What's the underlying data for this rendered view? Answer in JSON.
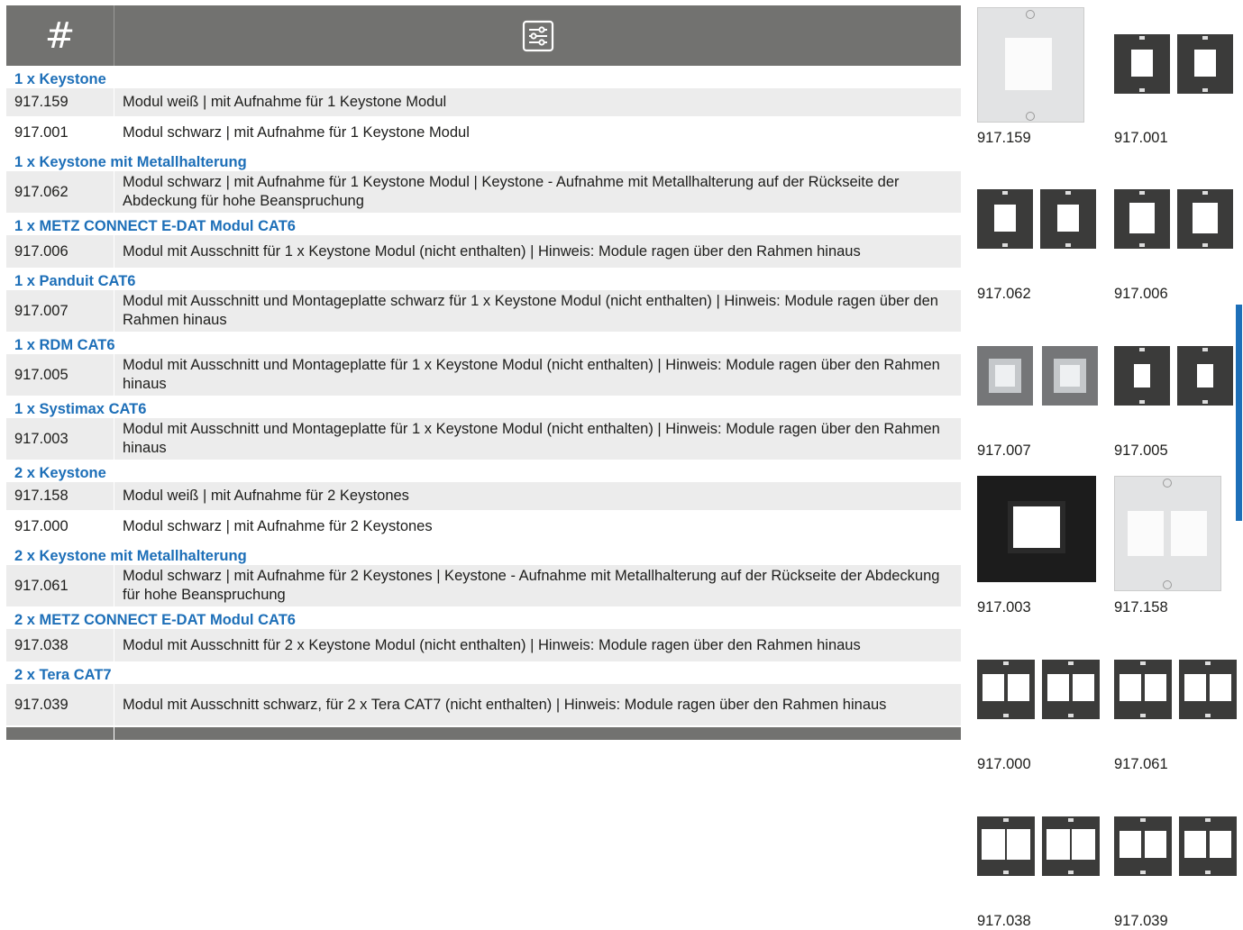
{
  "header": {
    "col1": "#",
    "col2_icon": "filter-settings-icon"
  },
  "rows": [
    {
      "type": "group",
      "label": "1 x Keystone"
    },
    {
      "type": "item",
      "num": "917.159",
      "desc": "Modul weiß | mit Aufnahme für 1 Keystone Modul",
      "shade": true
    },
    {
      "type": "item",
      "num": "917.001",
      "desc": "Modul schwarz | mit Aufnahme für 1 Keystone Modul",
      "shade": false
    },
    {
      "type": "group",
      "label": "1 x Keystone mit Metallhalterung"
    },
    {
      "type": "item",
      "num": "917.062",
      "desc": "Modul schwarz | mit Aufnahme für 1 Keystone Modul | Keystone - Aufnahme mit Metallhalterung auf der Rückseite der Abdeckung für hohe Beanspruchung",
      "shade": true
    },
    {
      "type": "group",
      "label": "1 x METZ CONNECT E-DAT Modul CAT6"
    },
    {
      "type": "item",
      "num": "917.006",
      "desc": "Modul mit Ausschnitt für 1 x Keystone Modul (nicht enthalten) | Hinweis: Module ragen über den Rahmen hinaus",
      "shade": true
    },
    {
      "type": "group",
      "label": "1 x Panduit CAT6"
    },
    {
      "type": "item",
      "num": "917.007",
      "desc": "Modul mit Ausschnitt und Montageplatte schwarz für 1 x Keystone Modul (nicht enthalten) | Hinweis: Module ragen über den Rahmen hinaus",
      "shade": true
    },
    {
      "type": "group",
      "label": "1 x RDM CAT6"
    },
    {
      "type": "item",
      "num": "917.005",
      "desc": "Modul mit Ausschnitt und Montageplatte für 1 x Keystone Modul (nicht enthalten) | Hinweis: Module ragen über den Rahmen hinaus",
      "shade": true
    },
    {
      "type": "group",
      "label": "1 x Systimax CAT6"
    },
    {
      "type": "item",
      "num": "917.003",
      "desc": "Modul mit Ausschnitt und Montageplatte für 1 x Keystone Modul (nicht enthalten) | Hinweis: Module ragen über den Rahmen hinaus",
      "shade": true
    },
    {
      "type": "group",
      "label": "2 x Keystone"
    },
    {
      "type": "item",
      "num": "917.158",
      "desc": "Modul weiß | mit Aufnahme für 2 Keystones",
      "shade": true
    },
    {
      "type": "item",
      "num": "917.000",
      "desc": "Modul schwarz | mit Aufnahme für 2 Keystones",
      "shade": false
    },
    {
      "type": "group",
      "label": "2 x Keystone mit Metallhalterung"
    },
    {
      "type": "item",
      "num": "917.061",
      "desc": "Modul schwarz | mit Aufnahme für 2 Keystones | Keystone - Aufnahme mit Metallhalterung auf der Rückseite der Abdeckung für hohe Beanspruchung",
      "shade": true
    },
    {
      "type": "group",
      "label": "2 x METZ CONNECT E-DAT Modul CAT6"
    },
    {
      "type": "item",
      "num": "917.038",
      "desc": "Modul mit Ausschnitt für 2 x Keystone Modul (nicht enthalten) | Hinweis: Module ragen über den Rahmen hinaus",
      "shade": true
    },
    {
      "type": "group",
      "label": "2 x Tera CAT7"
    },
    {
      "type": "item",
      "num": "917.039",
      "desc": "Modul mit Ausschnitt schwarz, für 2 x Tera CAT7 (nicht enthalten) | Hinweis: Module ragen über den Rahmen hinaus",
      "shade": true
    }
  ],
  "gallery": [
    {
      "num": "917.159",
      "style": "white-single"
    },
    {
      "num": "917.001",
      "style": "black-pair-single"
    },
    {
      "num": "917.062",
      "style": "black-pair-single"
    },
    {
      "num": "917.006",
      "style": "black-pair-keyed"
    },
    {
      "num": "917.007",
      "style": "grey-pair"
    },
    {
      "num": "917.005",
      "style": "black-pair-small"
    },
    {
      "num": "917.003",
      "style": "black-frame"
    },
    {
      "num": "917.158",
      "style": "white-double"
    },
    {
      "num": "917.000",
      "style": "black-pair-double"
    },
    {
      "num": "917.061",
      "style": "black-pair-double"
    },
    {
      "num": "917.038",
      "style": "black-pair-double-keyed"
    },
    {
      "num": "917.039",
      "style": "black-pair-double"
    }
  ],
  "colors": {
    "header": "#727270",
    "accent": "#1d6fb8",
    "shade": "#ececec"
  }
}
